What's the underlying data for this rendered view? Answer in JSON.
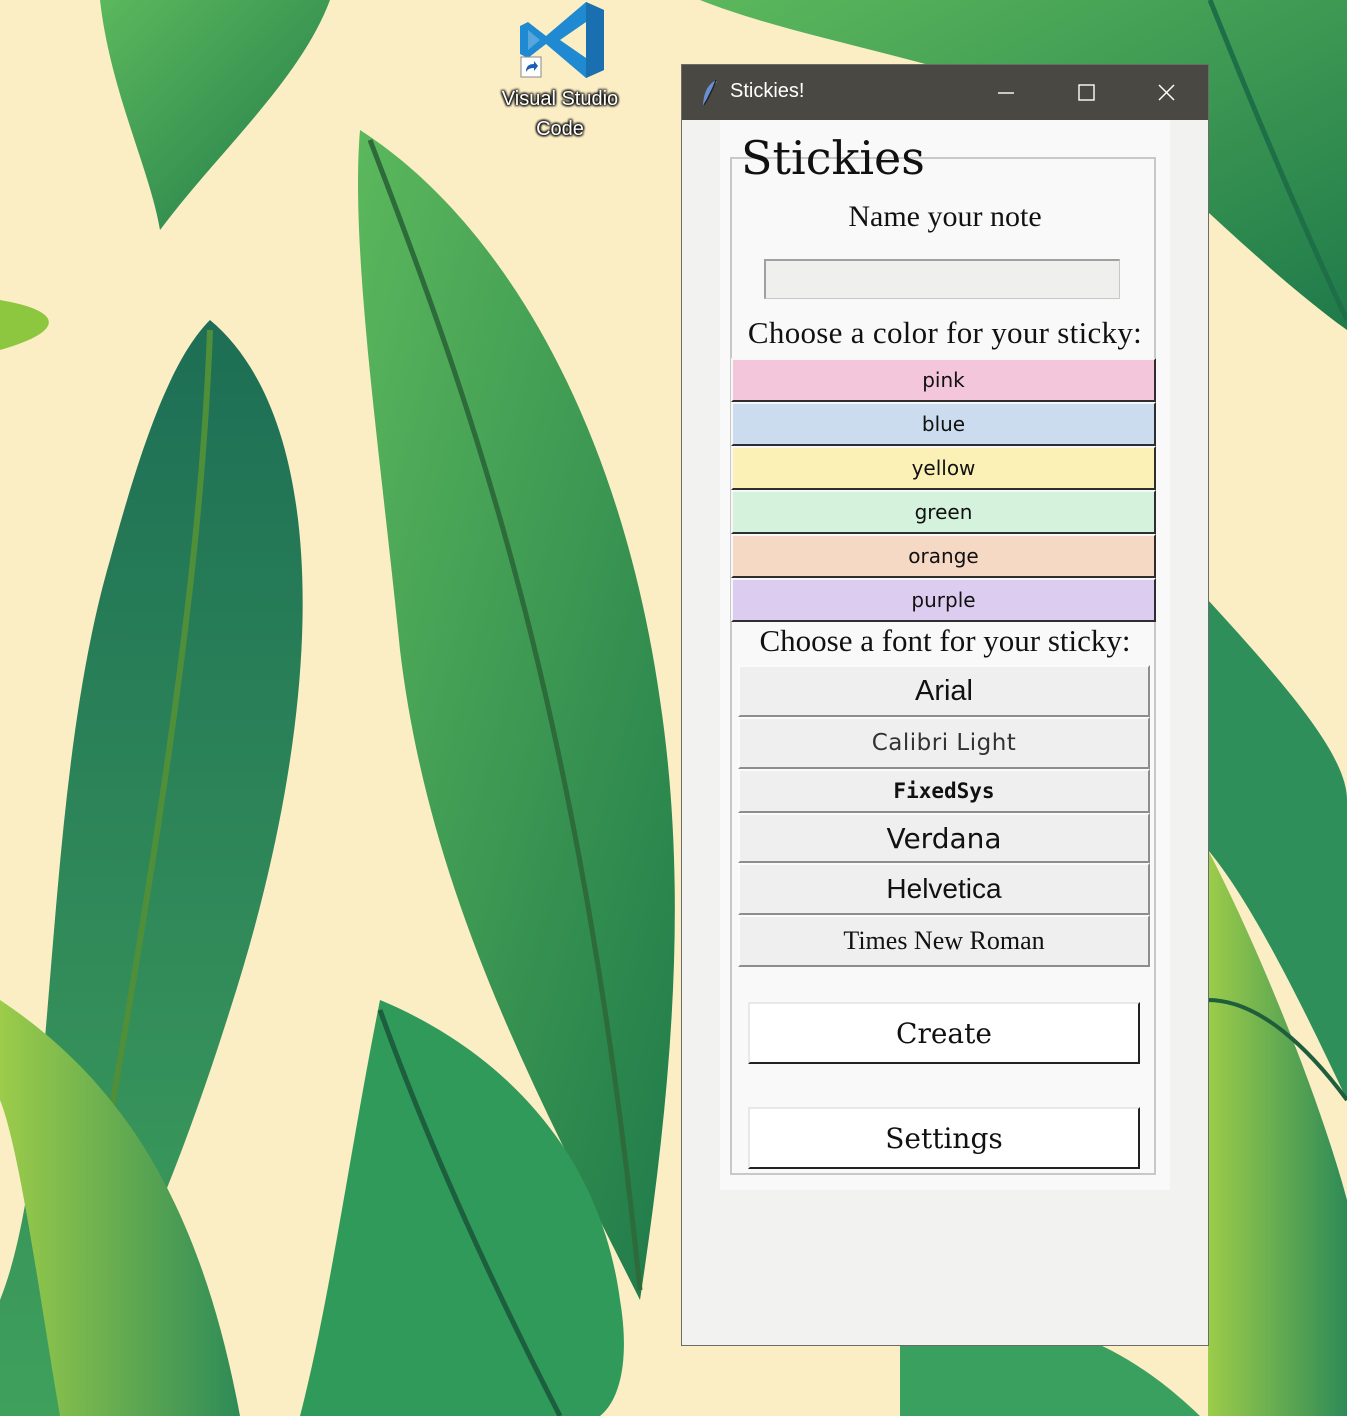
{
  "desktop": {
    "icon_label_line1": "Visual Studio",
    "icon_label_line2": "Code",
    "icon_name": "vscode-icon"
  },
  "window": {
    "title": "Stickies!",
    "icon_name": "feather-icon",
    "controls": {
      "minimize": "minimize-icon",
      "maximize": "maximize-icon",
      "close": "close-icon"
    }
  },
  "app": {
    "frame_title": "Stickies",
    "name_label": "Name your note",
    "name_value": "",
    "color_label": "Choose a color for your sticky:",
    "colors": [
      {
        "label": "pink",
        "hex": "#f3c6dc"
      },
      {
        "label": "blue",
        "hex": "#cadcee"
      },
      {
        "label": "yellow",
        "hex": "#fbf1b6"
      },
      {
        "label": "green",
        "hex": "#d4f2dc"
      },
      {
        "label": "orange",
        "hex": "#f5d9c5"
      },
      {
        "label": "purple",
        "hex": "#dccdf0"
      }
    ],
    "font_label": "Choose a font for your sticky:",
    "fonts": [
      "Arial",
      "Calibri Light",
      "FixedSys",
      "Verdana",
      "Helvetica",
      "Times New Roman"
    ],
    "create_label": "Create",
    "settings_label": "Settings"
  }
}
